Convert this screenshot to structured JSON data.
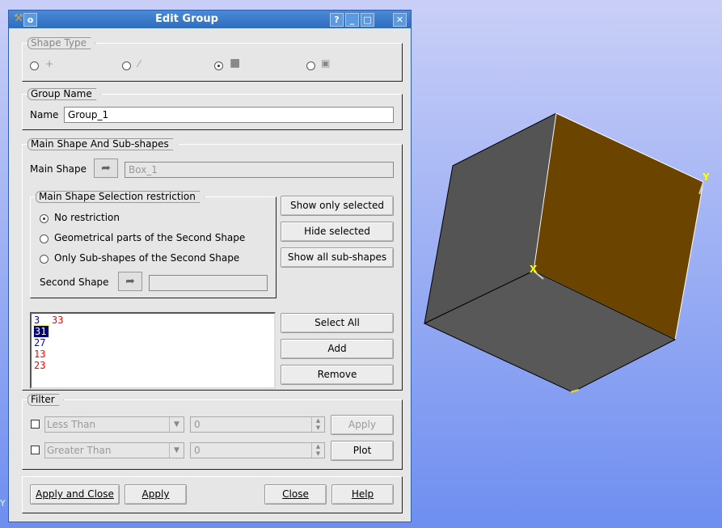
{
  "dialog": {
    "title": "Edit Group",
    "help_btn": "?",
    "min_btn": "_",
    "max_btn": "□",
    "close_btn": "✕"
  },
  "shape_type": {
    "title": "Shape Type",
    "options": [
      {
        "icon": "vertex-icon",
        "glyph": "+",
        "selected": false
      },
      {
        "icon": "edge-icon",
        "glyph": "⁄",
        "selected": false
      },
      {
        "icon": "face-icon",
        "glyph": "■",
        "selected": true
      },
      {
        "icon": "solid-icon",
        "glyph": "▣",
        "selected": false
      }
    ]
  },
  "group_name": {
    "title": "Group Name",
    "label": "Name",
    "value": "Group_1"
  },
  "main_shape": {
    "title": "Main Shape And Sub-shapes",
    "label": "Main Shape",
    "value": "Box_1",
    "restriction": {
      "title": "Main Shape Selection restriction",
      "options": [
        {
          "label": "No restriction",
          "selected": true
        },
        {
          "label": "Geometrical parts of the Second Shape",
          "selected": false
        },
        {
          "label": "Only Sub-shapes of the Second Shape",
          "selected": false
        }
      ],
      "second_label": "Second Shape",
      "second_value": ""
    },
    "buttons": {
      "show_only": "Show only selected",
      "hide": "Hide selected",
      "show_all": "Show all sub-shapes",
      "select_all": "Select All",
      "add": "Add",
      "remove": "Remove"
    },
    "ids": [
      {
        "text": "3",
        "color": "#0000ff"
      },
      {
        "text": "33",
        "color": "#ff0000"
      },
      {
        "text": "31",
        "color": "#ffffff",
        "selected": true
      },
      {
        "text": "27",
        "color": "#0000ff"
      },
      {
        "text": "13",
        "color": "#ff0000"
      },
      {
        "text": "23",
        "color": "#ff0000"
      }
    ]
  },
  "filter": {
    "title": "Filter",
    "less": "Less Than",
    "less_value": "0",
    "greater": "Greater Than",
    "greater_value": "0",
    "apply": "Apply",
    "plot": "Plot"
  },
  "footer": {
    "apply_close": "Apply and Close",
    "apply": "Apply",
    "close": "Close",
    "help": "Help"
  },
  "viewer": {
    "axis_x": "X",
    "axis_y": "Y",
    "corner_axis": "Y",
    "colors": {
      "face_left": "#545454",
      "face_right": "#6b4400",
      "face_bottom": "#585858"
    }
  }
}
